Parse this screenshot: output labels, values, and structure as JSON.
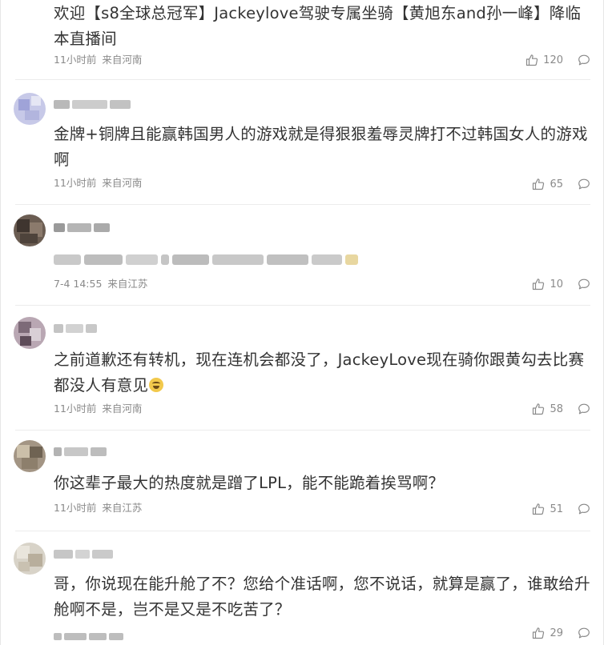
{
  "comments": [
    {
      "username": "",
      "text": "欢迎【s8全球总冠军】Jackeylove驾驶专属坐骑【黄旭东and孙一峰】降临本直播间",
      "time": "11小时前",
      "location": "来自河南",
      "likes": "120"
    },
    {
      "username": "",
      "text": "金牌+铜牌且能赢韩国男人的游戏就是得狠狠羞辱灵牌打不过韩国女人的游戏啊",
      "time": "11小时前",
      "location": "来自河南",
      "likes": "65"
    },
    {
      "username": "",
      "text": "",
      "time": "7-4 14:55",
      "location": "来自江苏",
      "likes": "10"
    },
    {
      "username": "",
      "text": "之前道歉还有转机，现在连机会都没了，JackeyLove现在骑你跟黄勾去比赛都没人有意见",
      "emoji": "laughing-crying-emoji",
      "time": "11小时前",
      "location": "来自河南",
      "likes": "58"
    },
    {
      "username": "",
      "text": "你这辈子最大的热度就是蹭了LPL，能不能跪着挨骂啊？",
      "time": "11小时前",
      "location": "来自江苏",
      "likes": "51"
    },
    {
      "username": "",
      "text": "哥，你说现在能升舱了不？您给个准话啊，您不说话，就算是赢了，谁敢给升舱啊不是，岂不是又是不吃苦了？",
      "time": "",
      "location": "",
      "likes": "29"
    }
  ],
  "icons": {
    "like": "thumbs-up-icon",
    "reply": "comment-bubble-icon"
  },
  "colors": {
    "text": "#333333",
    "meta": "#8a8a8a",
    "divider": "#ececec"
  }
}
